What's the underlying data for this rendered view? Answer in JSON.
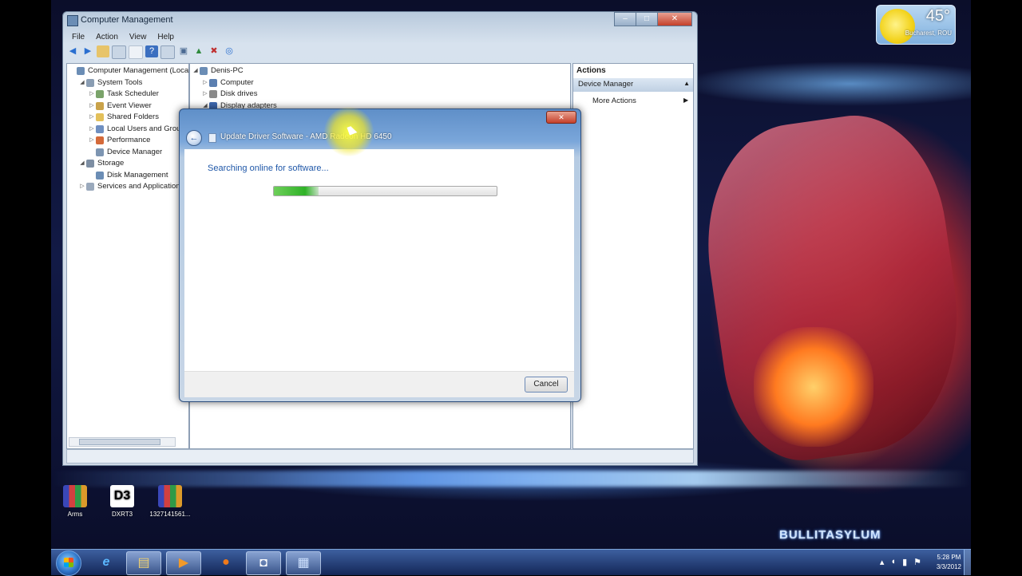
{
  "weather": {
    "temperature": "45°",
    "location": "Bucharest, ROU"
  },
  "computer_management": {
    "title": "Computer Management",
    "menu": [
      "File",
      "Action",
      "View",
      "Help"
    ],
    "left_tree": [
      {
        "label": "Computer Management (Local",
        "level": 0,
        "expander": ""
      },
      {
        "label": "System Tools",
        "level": 1,
        "expander": "◢"
      },
      {
        "label": "Task Scheduler",
        "level": 2,
        "expander": "▷"
      },
      {
        "label": "Event Viewer",
        "level": 2,
        "expander": "▷"
      },
      {
        "label": "Shared Folders",
        "level": 2,
        "expander": "▷"
      },
      {
        "label": "Local Users and Group",
        "level": 2,
        "expander": "▷"
      },
      {
        "label": "Performance",
        "level": 2,
        "expander": "▷"
      },
      {
        "label": "Device Manager",
        "level": 2,
        "expander": ""
      },
      {
        "label": "Storage",
        "level": 1,
        "expander": "◢"
      },
      {
        "label": "Disk Management",
        "level": 2,
        "expander": ""
      },
      {
        "label": "Services and Applications",
        "level": 1,
        "expander": "▷"
      }
    ],
    "device_tree": [
      {
        "label": "Denis-PC",
        "level": 0,
        "expander": "◢"
      },
      {
        "label": "Computer",
        "level": 1,
        "expander": "▷"
      },
      {
        "label": "Disk drives",
        "level": 1,
        "expander": "▷"
      },
      {
        "label": "Display adapters",
        "level": 1,
        "expander": "◢"
      }
    ],
    "actions": {
      "header": "Actions",
      "selected": "Device Manager",
      "more": "More Actions"
    }
  },
  "dialog": {
    "title": "Update Driver Software - AMD Radeon HD 6450",
    "status": "Searching online for software...",
    "progress": 0.2,
    "cancel_label": "Cancel"
  },
  "desktop_icons": [
    {
      "label": "Arms",
      "type": "winrar"
    },
    {
      "label": "DXRT3",
      "type": "dx3"
    },
    {
      "label": "1327141561...",
      "type": "winrar"
    }
  ],
  "watermark": "BULLITASYLUM",
  "taskbar": {
    "apps": [
      "internet-explorer",
      "explorer",
      "media-player",
      "firefox",
      "outlook",
      "computer-management"
    ],
    "time": "5:28 PM",
    "date": "3/3/2012"
  },
  "colors": {
    "progress_fill": "#2fb227",
    "status_text": "#1f57a8"
  }
}
